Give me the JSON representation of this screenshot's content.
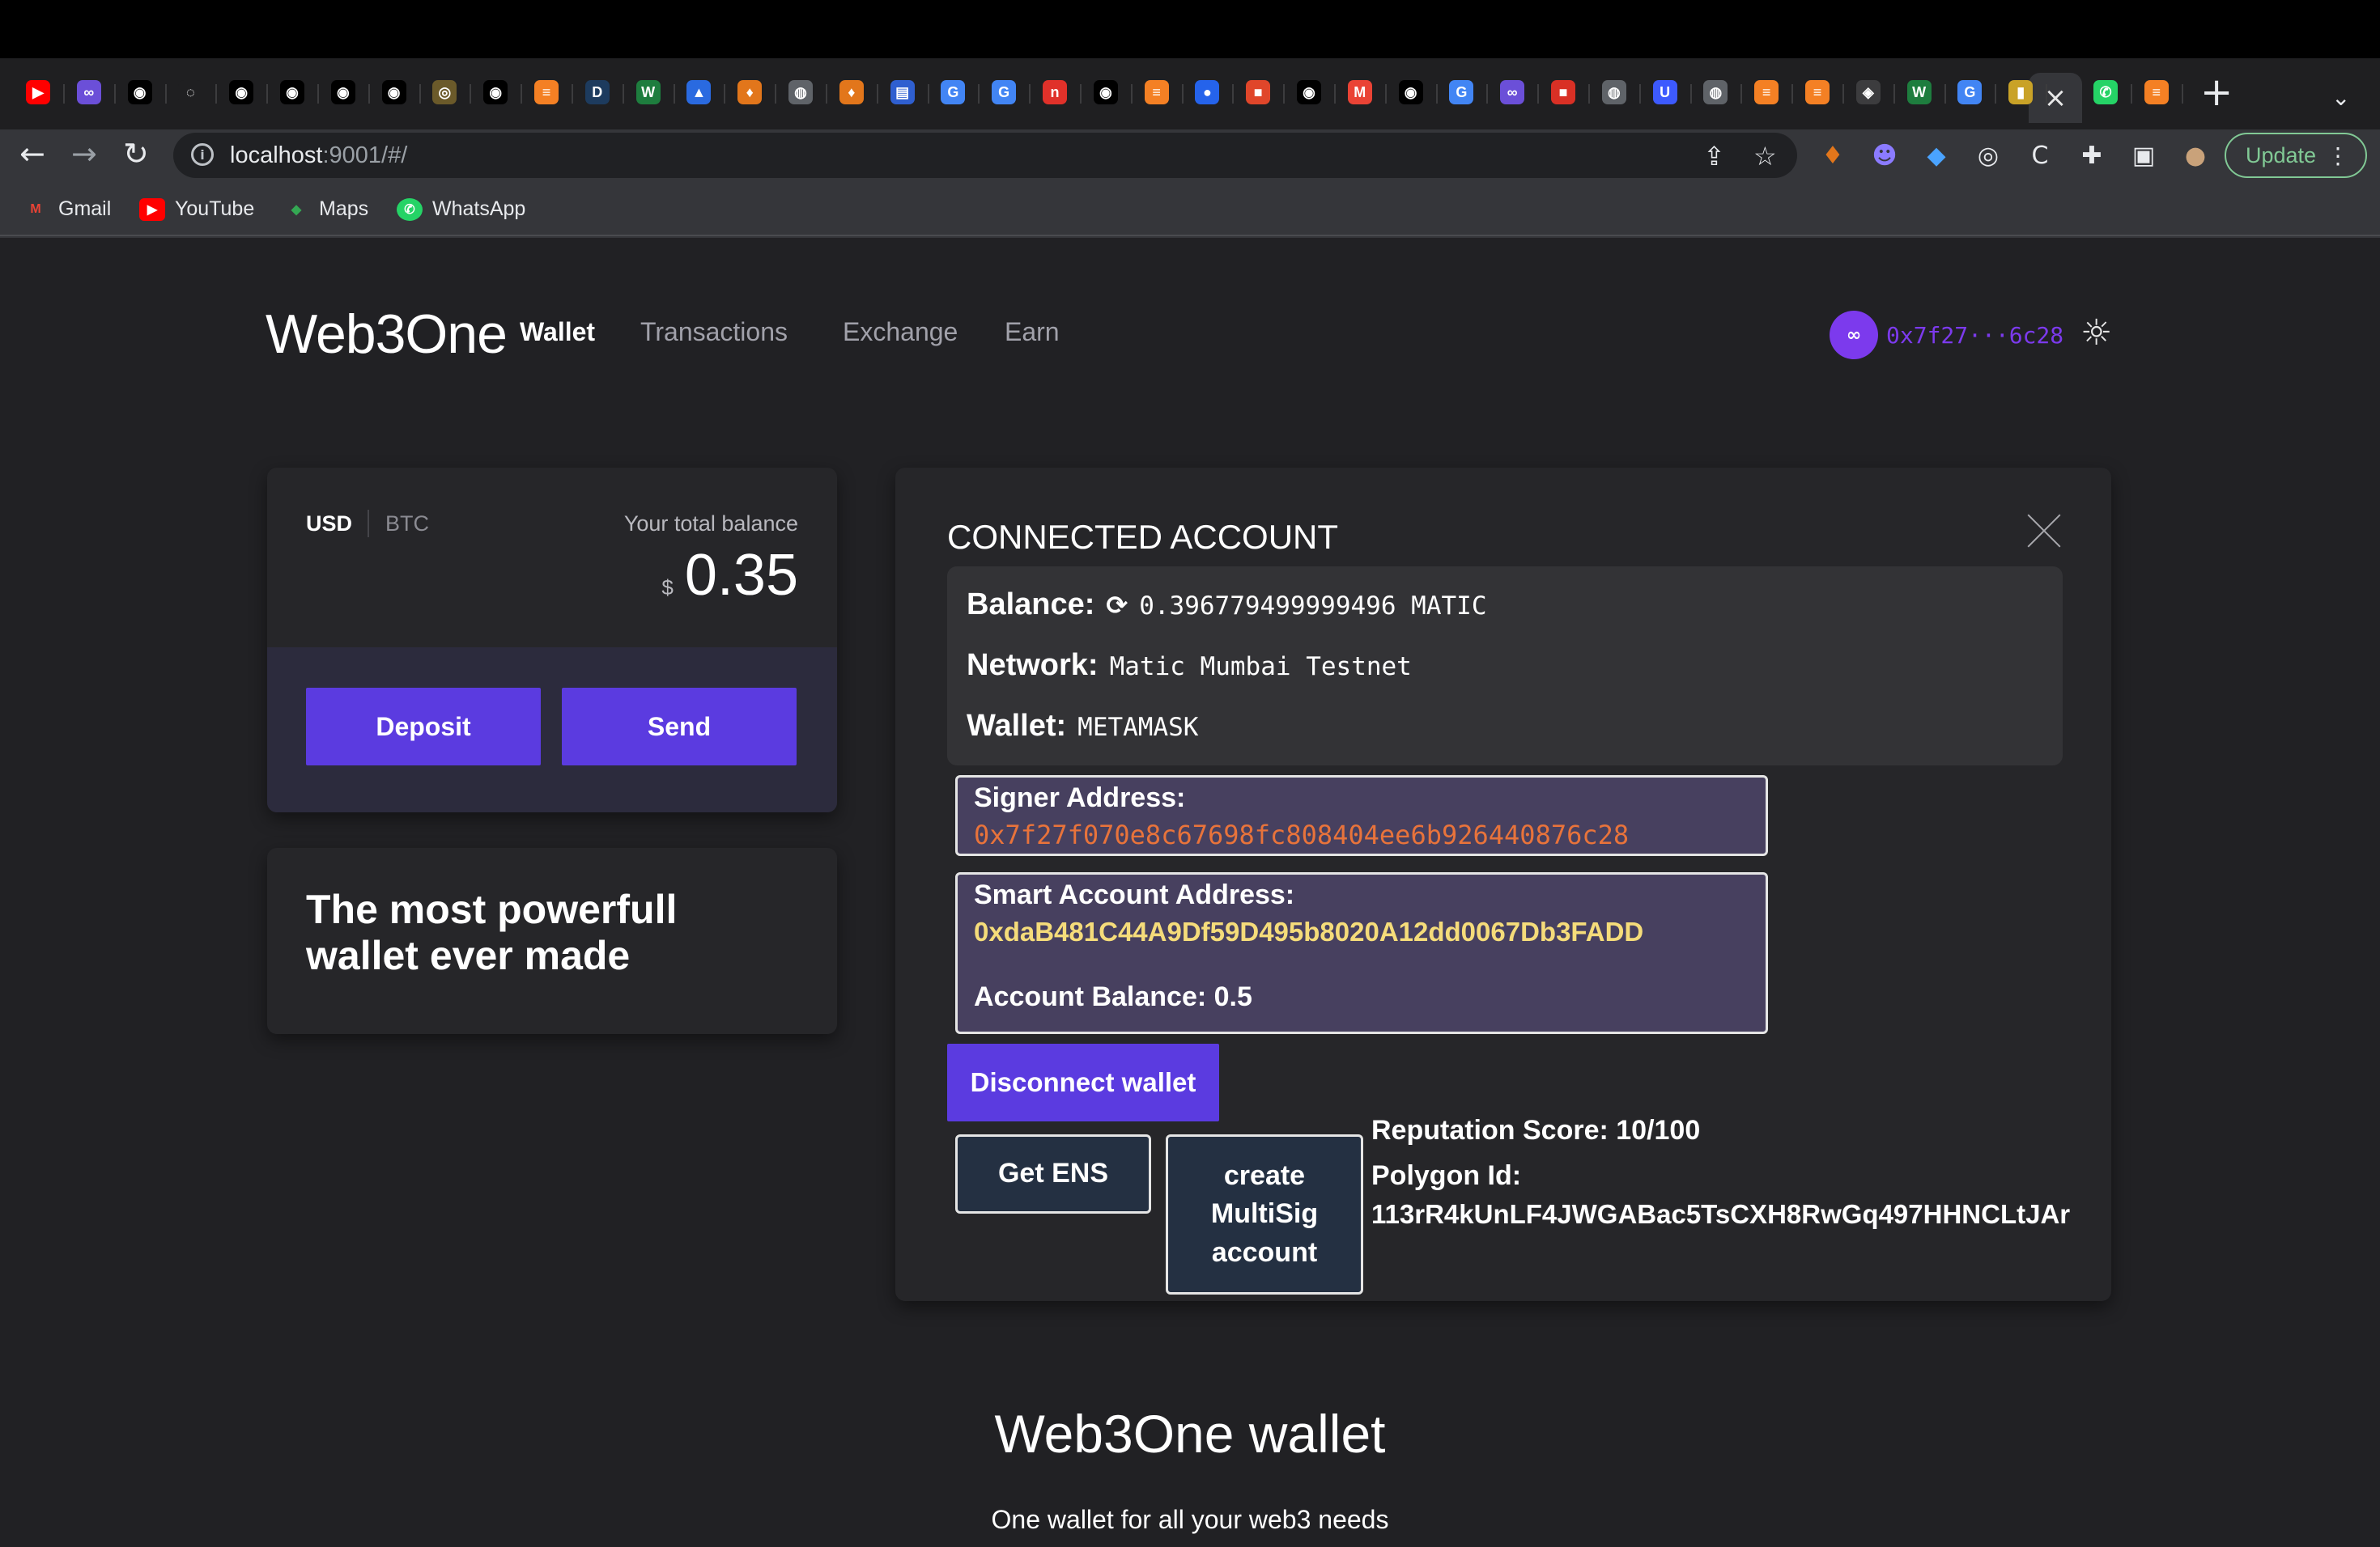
{
  "browser": {
    "url_host": "localhost",
    "url_rest": ":9001/#/",
    "update_label": "Update",
    "bookmarks": [
      {
        "label": "Gmail",
        "icon": "gmail-icon",
        "glyph": "M",
        "color": "#ea4335"
      },
      {
        "label": "YouTube",
        "icon": "youtube-icon",
        "glyph": "▶",
        "color": "#ff0000"
      },
      {
        "label": "Maps",
        "icon": "maps-icon",
        "glyph": "◆",
        "color": "#34a853"
      },
      {
        "label": "WhatsApp",
        "icon": "whatsapp-icon",
        "glyph": "✆",
        "color": "#25d366"
      }
    ],
    "tabs": [
      {
        "icon": "youtube-icon",
        "glyph": "▶",
        "bg": "#ff0000"
      },
      {
        "icon": "infinity-icon",
        "glyph": "∞",
        "bg": "#6b4fd8"
      },
      {
        "icon": "github-icon",
        "glyph": "◉",
        "bg": "#000000"
      },
      {
        "icon": "loading-icon",
        "glyph": "◌",
        "bg": "#1f1f21"
      },
      {
        "icon": "github-icon",
        "glyph": "◉",
        "bg": "#000000"
      },
      {
        "icon": "github-icon",
        "glyph": "◉",
        "bg": "#000000"
      },
      {
        "icon": "github-icon",
        "glyph": "◉",
        "bg": "#000000"
      },
      {
        "icon": "github-icon",
        "glyph": "◉",
        "bg": "#000000"
      },
      {
        "icon": "coin-icon",
        "glyph": "◎",
        "bg": "#6b5a2a"
      },
      {
        "icon": "github-icon",
        "glyph": "◉",
        "bg": "#000000"
      },
      {
        "icon": "stackoverflow-icon",
        "glyph": "≡",
        "bg": "#f48024"
      },
      {
        "icon": "d-icon",
        "glyph": "D",
        "bg": "#1d3b5e"
      },
      {
        "icon": "w3-icon",
        "glyph": "W",
        "bg": "#1e7d3e"
      },
      {
        "icon": "triangle-icon",
        "glyph": "▲",
        "bg": "#2a6ae0"
      },
      {
        "icon": "metamask-icon",
        "glyph": "♦",
        "bg": "#e2761b"
      },
      {
        "icon": "globe-icon",
        "glyph": "◍",
        "bg": "#5f6368"
      },
      {
        "icon": "metamask-icon",
        "glyph": "♦",
        "bg": "#e2761b"
      },
      {
        "icon": "book-icon",
        "glyph": "▤",
        "bg": "#2f5fd0"
      },
      {
        "icon": "google-icon",
        "glyph": "G",
        "bg": "#4285f4"
      },
      {
        "icon": "google-icon",
        "glyph": "G",
        "bg": "#4285f4"
      },
      {
        "icon": "n-icon",
        "glyph": "n",
        "bg": "#e0312a"
      },
      {
        "icon": "github-icon",
        "glyph": "◉",
        "bg": "#000000"
      },
      {
        "icon": "stackoverflow-icon",
        "glyph": "≡",
        "bg": "#f48024"
      },
      {
        "icon": "blue-circle-icon",
        "glyph": "●",
        "bg": "#2563eb"
      },
      {
        "icon": "red-square-icon",
        "glyph": "■",
        "bg": "#e0462a"
      },
      {
        "icon": "github-icon",
        "glyph": "◉",
        "bg": "#000000"
      },
      {
        "icon": "gmail-icon",
        "glyph": "M",
        "bg": "#ea4335"
      },
      {
        "icon": "github-icon",
        "glyph": "◉",
        "bg": "#000000"
      },
      {
        "icon": "google-icon",
        "glyph": "G",
        "bg": "#4285f4"
      },
      {
        "icon": "infinity-icon",
        "glyph": "∞",
        "bg": "#6b4fd8"
      },
      {
        "icon": "lock-icon",
        "glyph": "■",
        "bg": "#d93025"
      },
      {
        "icon": "globe-icon",
        "glyph": "◍",
        "bg": "#5f6368"
      },
      {
        "icon": "u-icon",
        "glyph": "U",
        "bg": "#3d5afe"
      },
      {
        "icon": "globe-icon",
        "glyph": "◍",
        "bg": "#5f6368"
      },
      {
        "icon": "stackoverflow-icon",
        "glyph": "≡",
        "bg": "#f48024"
      },
      {
        "icon": "stackoverflow-icon",
        "glyph": "≡",
        "bg": "#f48024"
      },
      {
        "icon": "diamond-icon",
        "glyph": "◈",
        "bg": "#3c3c3e"
      },
      {
        "icon": "w3-icon",
        "glyph": "W",
        "bg": "#1e7d3e"
      },
      {
        "icon": "google-icon",
        "glyph": "G",
        "bg": "#4285f4"
      },
      {
        "icon": "flag-icon",
        "glyph": "▮",
        "bg": "#c9a227"
      }
    ],
    "tabs_after_active": [
      {
        "icon": "whatsapp-icon",
        "glyph": "✆",
        "bg": "#25d366"
      },
      {
        "icon": "stackoverflow-icon",
        "glyph": "≡",
        "bg": "#f48024"
      }
    ]
  },
  "app": {
    "brand": "Web3One",
    "nav": [
      "Wallet",
      "Transactions",
      "Exchange",
      "Earn"
    ],
    "account_short": "0x7f27···6c28"
  },
  "balance_card": {
    "currency_usd": "USD",
    "currency_btc": "BTC",
    "total_label": "Your total balance",
    "currency_symbol": "$",
    "total_value": "0.35",
    "deposit_label": "Deposit",
    "send_label": "Send"
  },
  "tagline": "The most powerfull wallet ever made",
  "account": {
    "title": "CONNECTED ACCOUNT",
    "balance_label": "Balance:",
    "balance_value": "0.396779499999496 MATIC",
    "network_label": "Network:",
    "network_value": "Matic Mumbai Testnet",
    "wallet_label": "Wallet:",
    "wallet_value": "METAMASK",
    "signer_label": "Signer Address:",
    "signer_value": "0x7f27f070e8c67698fc808404ee6b926440876c28",
    "smart_label": "Smart Account Address:",
    "smart_value": "0xdaB481C44A9Df59D495b8020A12dd0067Db3FADD",
    "account_balance": "Account Balance: 0.5",
    "disconnect_label": "Disconnect wallet",
    "ens_label": "Get ENS",
    "multisig_label": "create MultiSig account",
    "reputation": "Reputation Score: 10/100",
    "polygon_label": "Polygon Id:",
    "polygon_value": "113rR4kUnLF4JWGABac5TsCXH8RwGq497HHNCLtJAr"
  },
  "footer": {
    "title": "Web3One wallet",
    "subtitle": "One wallet for all your web3 needs"
  }
}
